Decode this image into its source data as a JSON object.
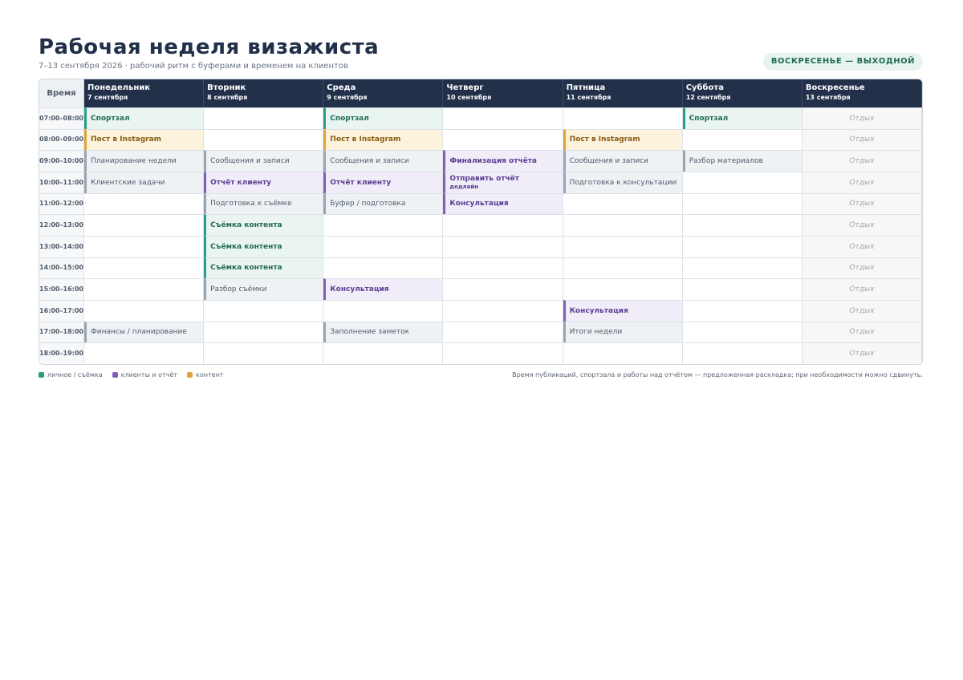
{
  "header": {
    "title": "Рабочая неделя визажиста",
    "subtitle": "7–13 сентября 2026 · рабочий ритм с буферами и временем на клиентов",
    "badge": "ВОСКРЕСЕНЬЕ — ВЫХОДНОЙ"
  },
  "schedule": {
    "time_header": "Время",
    "days": [
      {
        "name": "Понедельник",
        "date": "7 сентября"
      },
      {
        "name": "Вторник",
        "date": "8 сентября"
      },
      {
        "name": "Среда",
        "date": "9 сентября"
      },
      {
        "name": "Четверг",
        "date": "10 сентября"
      },
      {
        "name": "Пятница",
        "date": "11 сентября"
      },
      {
        "name": "Суббота",
        "date": "12 сентября"
      },
      {
        "name": "Воскресенье",
        "date": "13 сентября"
      }
    ],
    "slots": [
      {
        "start": "07:00–",
        "end": "08:00",
        "cells": [
          {
            "label": "Спортзал",
            "category": "personal"
          },
          null,
          {
            "label": "Спортзал",
            "category": "personal"
          },
          null,
          null,
          {
            "label": "Спортзал",
            "category": "personal"
          },
          {
            "label": "Отдых",
            "category": "rest"
          }
        ]
      },
      {
        "start": "08:00–",
        "end": "09:00",
        "cells": [
          {
            "label": "Пост в Instagram",
            "category": "content"
          },
          null,
          {
            "label": "Пост в Instagram",
            "category": "content"
          },
          null,
          {
            "label": "Пост в Instagram",
            "category": "content"
          },
          null,
          {
            "label": "Отдых",
            "category": "rest"
          }
        ]
      },
      {
        "start": "09:00–",
        "end": "10:00",
        "cells": [
          {
            "label": "Планирование недели",
            "category": "routine"
          },
          {
            "label": "Сообщения и записи",
            "category": "routine"
          },
          {
            "label": "Сообщения и записи",
            "category": "routine"
          },
          {
            "label": "Финализация отчёта",
            "category": "client"
          },
          {
            "label": "Сообщения и записи",
            "category": "routine"
          },
          {
            "label": "Разбор материалов",
            "category": "routine"
          },
          {
            "label": "Отдых",
            "category": "rest"
          }
        ]
      },
      {
        "start": "10:00–",
        "end": "11:00",
        "cells": [
          {
            "label": "Клиентские задачи",
            "category": "routine"
          },
          {
            "label": "Отчёт клиенту",
            "category": "client"
          },
          {
            "label": "Отчёт клиенту",
            "category": "client"
          },
          {
            "label": "Отправить отчёт",
            "sub": "дедлайн",
            "category": "client"
          },
          {
            "label": "Подготовка к консультации",
            "category": "routine"
          },
          null,
          {
            "label": "Отдых",
            "category": "rest"
          }
        ]
      },
      {
        "start": "11:00–",
        "end": "12:00",
        "cells": [
          null,
          {
            "label": "Подготовка к съёмке",
            "category": "routine"
          },
          {
            "label": "Буфер / подготовка",
            "category": "routine"
          },
          {
            "label": "Консультация",
            "category": "client"
          },
          null,
          null,
          {
            "label": "Отдых",
            "category": "rest"
          }
        ]
      },
      {
        "start": "12:00–",
        "end": "13:00",
        "cells": [
          null,
          {
            "label": "Съёмка контента",
            "category": "personal"
          },
          null,
          null,
          null,
          null,
          {
            "label": "Отдых",
            "category": "rest"
          }
        ]
      },
      {
        "start": "13:00–",
        "end": "14:00",
        "cells": [
          null,
          {
            "label": "Съёмка контента",
            "category": "personal"
          },
          null,
          null,
          null,
          null,
          {
            "label": "Отдых",
            "category": "rest"
          }
        ]
      },
      {
        "start": "14:00–",
        "end": "15:00",
        "cells": [
          null,
          {
            "label": "Съёмка контента",
            "category": "personal"
          },
          null,
          null,
          null,
          null,
          {
            "label": "Отдых",
            "category": "rest"
          }
        ]
      },
      {
        "start": "15:00–",
        "end": "16:00",
        "cells": [
          null,
          {
            "label": "Разбор съёмки",
            "category": "routine"
          },
          {
            "label": "Консультация",
            "category": "client"
          },
          null,
          null,
          null,
          {
            "label": "Отдых",
            "category": "rest"
          }
        ]
      },
      {
        "start": "16:00–",
        "end": "17:00",
        "cells": [
          null,
          null,
          null,
          null,
          {
            "label": "Консультация",
            "category": "client"
          },
          null,
          {
            "label": "Отдых",
            "category": "rest"
          }
        ]
      },
      {
        "start": "17:00–",
        "end": "18:00",
        "cells": [
          {
            "label": "Финансы / планирование",
            "category": "routine"
          },
          null,
          {
            "label": "Заполнение заметок",
            "category": "routine"
          },
          null,
          {
            "label": "Итоги недели",
            "category": "routine"
          },
          null,
          {
            "label": "Отдых",
            "category": "rest"
          }
        ]
      },
      {
        "start": "18:00–",
        "end": "19:00",
        "cells": [
          null,
          null,
          null,
          null,
          null,
          null,
          {
            "label": "Отдых",
            "category": "rest"
          }
        ]
      }
    ]
  },
  "legend": [
    {
      "label": "личное / съёмка",
      "color": "#2a9d85"
    },
    {
      "label": "клиенты и отчёт",
      "color": "#7f5fb8"
    },
    {
      "label": "контент",
      "color": "#e0a435"
    }
  ],
  "footer_note": "Время публикаций, спортзала и работы над отчётом — предложенная раскладка; при необходимости можно сдвинуть."
}
